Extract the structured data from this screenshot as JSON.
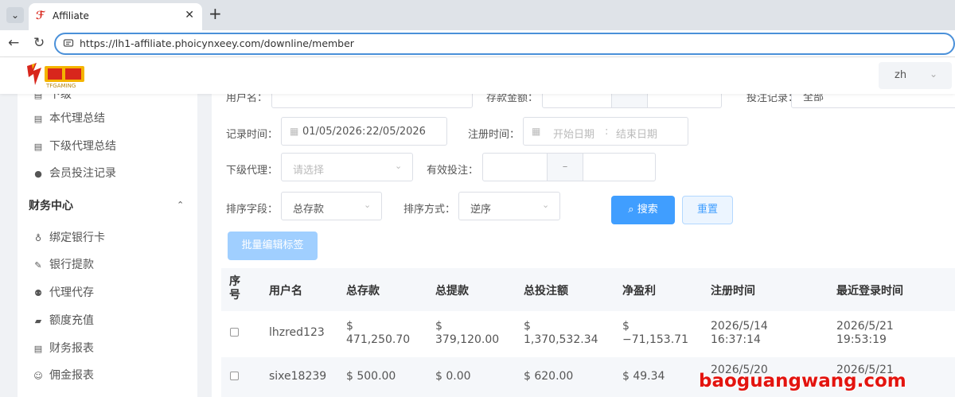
{
  "browser": {
    "tab_title": "Affiliate",
    "url": "https://lh1-affiliate.phoicynxeey.com/downline/member",
    "new_tab_symbol": "+",
    "close_symbol": "✕"
  },
  "header": {
    "logo_text": "TFGAMING",
    "language": "zh"
  },
  "sidebar": {
    "clipped_item": "下级",
    "items": [
      {
        "label": "本代理总结",
        "icon": "document-icon"
      },
      {
        "label": "下级代理总结",
        "icon": "document-icon"
      },
      {
        "label": "会员投注记录",
        "icon": "clock-icon"
      }
    ],
    "group": {
      "label": "财务中心",
      "expanded": true
    },
    "finance_items": [
      {
        "label": "绑定银行卡",
        "icon": "bank-icon"
      },
      {
        "label": "银行提款",
        "icon": "edit-icon"
      },
      {
        "label": "代理代存",
        "icon": "users-icon"
      },
      {
        "label": "额度充值",
        "icon": "wallet-icon"
      },
      {
        "label": "财务报表",
        "icon": "document-icon"
      },
      {
        "label": "佣金报表",
        "icon": "user-icon"
      }
    ]
  },
  "filters": {
    "username_label": "用户名：",
    "deposit_label": "存款金额：",
    "bet_record_label": "投注记录：",
    "bet_record_value": "全部",
    "range_separator": "–",
    "record_time_label": "记录时间：",
    "record_time_start": "01/05/2026",
    "record_time_end": "22/05/2026",
    "register_time_label": "注册时间：",
    "register_start_placeholder": "开始日期",
    "register_end_placeholder": "结束日期",
    "date_separator": ":",
    "sub_agent_label": "下级代理：",
    "sub_agent_placeholder": "请选择",
    "valid_bet_label": "有效投注：",
    "sort_field_label": "排序字段：",
    "sort_field_value": "总存款",
    "sort_order_label": "排序方式：",
    "sort_order_value": "逆序"
  },
  "buttons": {
    "search": "搜索",
    "reset": "重置",
    "batch_edit": "批量编辑标签"
  },
  "table": {
    "columns": [
      "序号",
      "用户名",
      "总存款",
      "总提款",
      "总投注额",
      "净盈利",
      "注册时间",
      "最近登录时间"
    ],
    "rows": [
      {
        "username": "lhzred123",
        "deposit": "$ 471,250.70",
        "withdraw": "$ 379,120.00",
        "bet": "$ 1,370,532.34",
        "profit": "$ −71,153.71",
        "register": "2026/5/14 16:37:14",
        "last_login": "2026/5/21 19:53:19"
      },
      {
        "username": "sixe18239",
        "deposit": "$ 500.00",
        "withdraw": "$ 0.00",
        "bet": "$ 620.00",
        "profit": "$ 49.34",
        "register": "2026/5/20",
        "last_login": "2026/5/21"
      }
    ]
  },
  "watermark": "baoguangwang.com"
}
